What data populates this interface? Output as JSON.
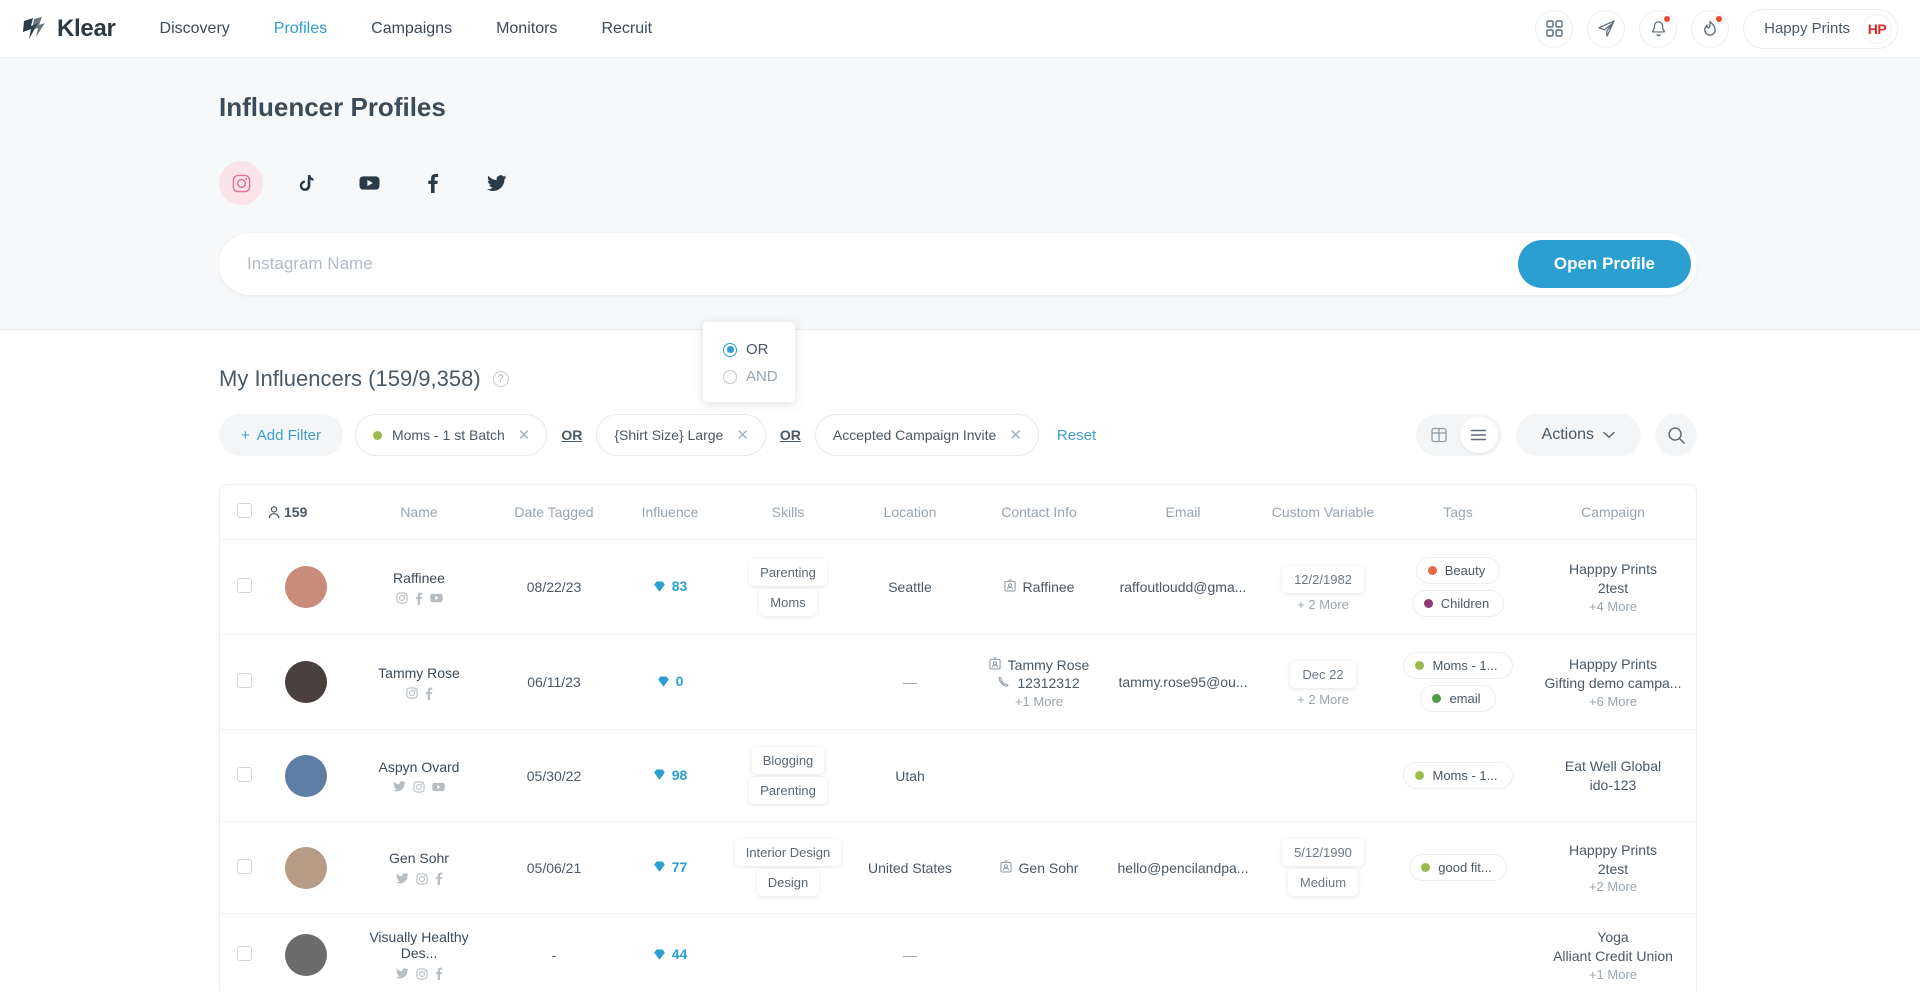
{
  "header": {
    "brand": "Klear",
    "nav": [
      {
        "label": "Discovery",
        "active": false
      },
      {
        "label": "Profiles",
        "active": true
      },
      {
        "label": "Campaigns",
        "active": false
      },
      {
        "label": "Monitors",
        "active": false
      },
      {
        "label": "Recruit",
        "active": false
      }
    ],
    "icons": [
      "apps-grid-icon",
      "paper-plane-icon",
      "bell-icon",
      "flame-icon"
    ],
    "account_name": "Happy Prints",
    "account_initials": "HP"
  },
  "search": {
    "page_title": "Influencer Profiles",
    "networks": [
      {
        "name": "instagram-icon",
        "active": true
      },
      {
        "name": "tiktok-icon",
        "active": false
      },
      {
        "name": "youtube-icon",
        "active": false
      },
      {
        "name": "facebook-icon",
        "active": false
      },
      {
        "name": "twitter-icon",
        "active": false
      }
    ],
    "placeholder": "Instagram Name",
    "value": "",
    "button_label": "Open Profile",
    "accent_color": "#2a9fd0"
  },
  "list": {
    "title": "My Influencers (159/9,358)",
    "add_filter_label": "Add Filter",
    "reset_label": "Reset",
    "actions_label": "Actions",
    "filters": [
      {
        "label": "Moms - 1 st Batch",
        "dot": "#9dbb4e",
        "has_dot": true
      },
      {
        "label": "{Shirt Size} Large",
        "has_dot": false
      },
      {
        "label": "Accepted Campaign Invite",
        "has_dot": false
      }
    ],
    "operators": [
      "OR",
      "OR"
    ],
    "operator_popover": {
      "options": [
        {
          "label": "OR",
          "selected": true
        },
        {
          "label": "AND",
          "selected": false
        }
      ]
    }
  },
  "table": {
    "selected_count": "159",
    "columns": [
      "Name",
      "Date Tagged",
      "Influence",
      "Skills",
      "Location",
      "Contact Info",
      "Email",
      "Custom Variable",
      "Tags",
      "Campaign"
    ],
    "rows": [
      {
        "name": "Raffinee",
        "socials": [
          "instagram-icon",
          "facebook-icon",
          "youtube-icon"
        ],
        "avatar_color": "#c98c7a",
        "date_tagged": "08/22/23",
        "influence": "83",
        "skills": [
          "Parenting",
          "Moms"
        ],
        "location": "Seattle",
        "contacts": [
          {
            "icon": "contact-card-icon",
            "text": "Raffinee"
          }
        ],
        "contacts_more": "",
        "email": "raffoutloudd@gma...",
        "custom_variables": [
          "12/2/1982"
        ],
        "custom_more": "+ 2 More",
        "tags": [
          {
            "label": "Beauty",
            "dot": "#e8694a"
          },
          {
            "label": "Children",
            "dot": "#8e3a78"
          }
        ],
        "campaigns": [
          "Happpy Prints",
          "2test"
        ],
        "campaign_more": "+4 More"
      },
      {
        "name": "Tammy Rose",
        "socials": [
          "instagram-icon",
          "facebook-icon"
        ],
        "avatar_color": "#4a3f3c",
        "date_tagged": "06/11/23",
        "influence": "0",
        "skills": [],
        "location": "—",
        "contacts": [
          {
            "icon": "contact-card-icon",
            "text": "Tammy Rose"
          },
          {
            "icon": "phone-icon",
            "text": "12312312"
          }
        ],
        "contacts_more": "+1 More",
        "email": "tammy.rose95@ou...",
        "custom_variables": [
          "Dec 22"
        ],
        "custom_more": "+ 2 More",
        "tags": [
          {
            "label": "Moms - 1...",
            "dot": "#9dbb4e"
          },
          {
            "label": "email",
            "dot": "#4e9b45"
          }
        ],
        "campaigns": [
          "Happpy Prints",
          "Gifting demo campa..."
        ],
        "campaign_more": "+6 More"
      },
      {
        "name": "Aspyn Ovard",
        "socials": [
          "twitter-icon",
          "instagram-icon",
          "youtube-icon"
        ],
        "avatar_color": "#5e7fa3",
        "date_tagged": "05/30/22",
        "influence": "98",
        "skills": [
          "Blogging",
          "Parenting"
        ],
        "location": "Utah",
        "contacts": [],
        "contacts_more": "",
        "email": "",
        "custom_variables": [],
        "custom_more": "",
        "tags": [
          {
            "label": "Moms - 1...",
            "dot": "#9dbb4e"
          }
        ],
        "campaigns": [
          "Eat Well Global",
          "ido-123"
        ],
        "campaign_more": ""
      },
      {
        "name": "Gen Sohr",
        "socials": [
          "twitter-icon",
          "instagram-icon",
          "facebook-icon"
        ],
        "avatar_color": "#b89b84",
        "date_tagged": "05/06/21",
        "influence": "77",
        "skills": [
          "Interior Design",
          "Design"
        ],
        "location": "United States",
        "contacts": [
          {
            "icon": "contact-card-icon",
            "text": "Gen Sohr"
          }
        ],
        "contacts_more": "",
        "email": "hello@pencilandpa...",
        "custom_variables": [
          "5/12/1990",
          "Medium"
        ],
        "custom_more": "",
        "tags": [
          {
            "label": "good fit...",
            "dot": "#9dbb4e"
          }
        ],
        "campaigns": [
          "Happpy Prints",
          "2test"
        ],
        "campaign_more": "+2 More"
      },
      {
        "name": "Visually Healthy Des...",
        "socials": [
          "twitter-icon",
          "instagram-icon",
          "facebook-icon"
        ],
        "avatar_color": "#6b6b6b",
        "date_tagged": "-",
        "influence": "44",
        "skills": [],
        "location": "—",
        "contacts": [],
        "contacts_more": "",
        "email": "",
        "custom_variables": [],
        "custom_more": "",
        "tags": [],
        "campaigns": [
          "Yoga",
          "Alliant Credit Union"
        ],
        "campaign_more": "+1 More"
      }
    ]
  }
}
